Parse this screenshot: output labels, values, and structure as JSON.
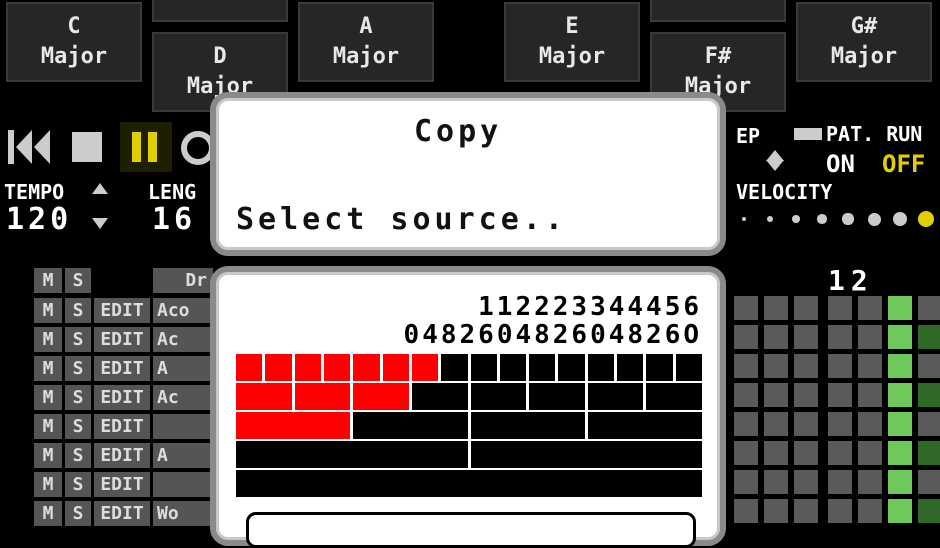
{
  "chords": [
    {
      "label1": "C",
      "label2": "Major"
    },
    {
      "label1": "D",
      "label2": "Major"
    },
    {
      "label1": "A",
      "label2": "Major"
    },
    {
      "label1": "E",
      "label2": "Major"
    },
    {
      "label1": "F#",
      "label2": "Major"
    },
    {
      "label1": "G#",
      "label2": "Major"
    }
  ],
  "transport": {
    "tempo_label": "TEMPO",
    "tempo_value": "120",
    "length_label": "LENG",
    "length_value": "16",
    "step_label": "EP",
    "pat_run_label": "PAT. RUN",
    "pat_on": "ON",
    "pat_off": "OFF",
    "velocity_label": "VELOCITY",
    "velocity_level": 8,
    "page_number": "12"
  },
  "tracks": {
    "header_name": "Dr",
    "rows": [
      {
        "m": "M",
        "s": "S",
        "edit": "EDIT",
        "name": "Aco"
      },
      {
        "m": "M",
        "s": "S",
        "edit": "EDIT",
        "name": "Ac"
      },
      {
        "m": "M",
        "s": "S",
        "edit": "EDIT",
        "name": "A"
      },
      {
        "m": "M",
        "s": "S",
        "edit": "EDIT",
        "name": "Ac"
      },
      {
        "m": "M",
        "s": "S",
        "edit": "EDIT",
        "name": ""
      },
      {
        "m": "M",
        "s": "S",
        "edit": "EDIT",
        "name": "A"
      },
      {
        "m": "M",
        "s": "S",
        "edit": "EDIT",
        "name": ""
      },
      {
        "m": "M",
        "s": "S",
        "edit": "EDIT",
        "name": "Wo"
      }
    ],
    "header_m": "M",
    "header_s": "S"
  },
  "dialog": {
    "title": "Copy",
    "message": "Select source..",
    "ruler_top": "112223344456",
    "ruler_bottom": "048260482604826O"
  },
  "colors": {
    "selected": "#ff0000",
    "pause": "#e0d000",
    "off": "#e0d000",
    "grid_green": "#6ec85a"
  }
}
